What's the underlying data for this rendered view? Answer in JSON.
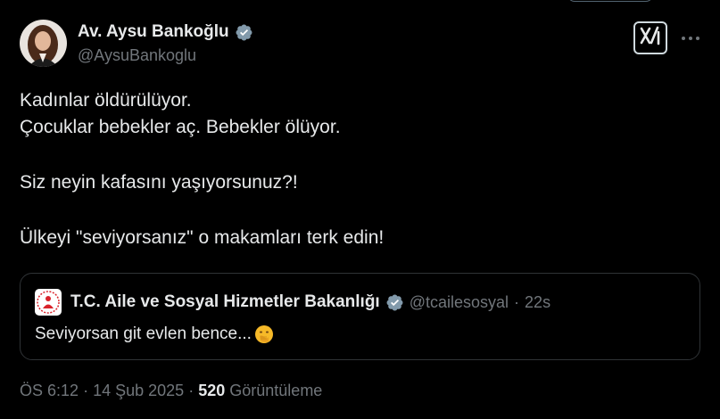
{
  "author": {
    "display_name": "Av. Aysu Bankoğlu",
    "handle": "@AysuBankoglu"
  },
  "icons": {
    "verified": "verified-badge-icon",
    "grok": "grok-icon",
    "more": "more-icon",
    "emoji": "face-with-hand-over-mouth-icon"
  },
  "tweet": {
    "line1": "Kadınlar öldürülüyor.",
    "line2": "Çocuklar bebekler aç. Bebekler ölüyor.",
    "line3": "Siz neyin kafasını yaşıyorsunuz?!",
    "line4": "Ülkeyi \"seviyorsanız\" o makamları terk edin!"
  },
  "quote": {
    "name": "T.C. Aile ve Sosyal Hizmetler Bakanlığı",
    "handle": "@tcailesosyal",
    "separator": "·",
    "time": "22s",
    "text": "Seviyorsan git evlen bence..."
  },
  "meta": {
    "time": "ÖS 6:12",
    "sep1": "·",
    "date": "14 Şub 2025",
    "sep2": "·",
    "views": "520",
    "views_label": "Görüntüleme"
  },
  "colors": {
    "background": "#000000",
    "text": "#e7e9ea",
    "secondary": "#71767b",
    "verified": "#829aab",
    "border": "#2f3336"
  }
}
